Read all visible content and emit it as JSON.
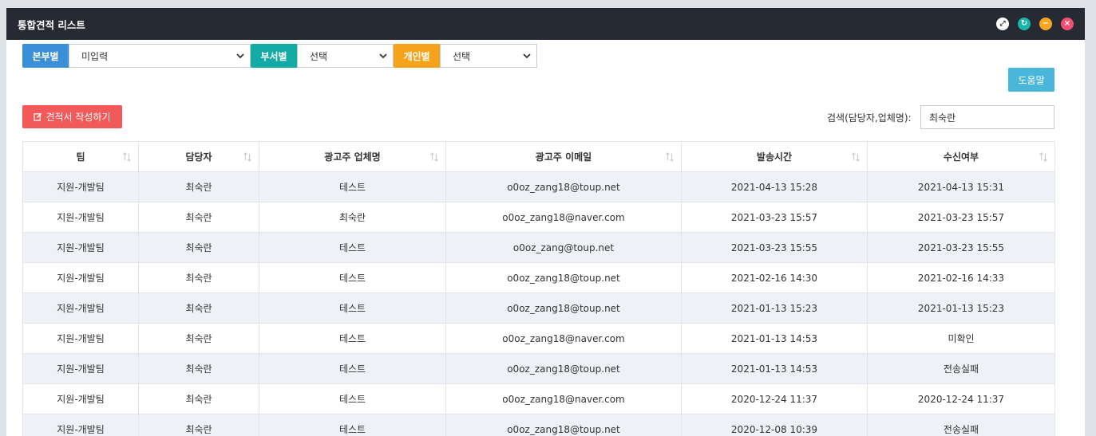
{
  "window": {
    "title": "통합견적 리스트"
  },
  "controls": {
    "expand": "⤢",
    "refresh": "↻",
    "minimize": "−",
    "close": "×"
  },
  "filters": [
    {
      "label": "본부별",
      "value": "미입력",
      "color": "#3b8fd6"
    },
    {
      "label": "부서별",
      "value": "선택",
      "color": "#14aaa6"
    },
    {
      "label": "개인별",
      "value": "선택",
      "color": "#f5a31a"
    }
  ],
  "help_button": "도움말",
  "write_button": "견적서 작성하기",
  "search": {
    "label": "검색(담당자,업체명):",
    "value": "최숙란"
  },
  "table": {
    "headers": [
      "팀",
      "담당자",
      "광고주 업체명",
      "광고주 이메일",
      "발송시간",
      "수신여부"
    ],
    "rows": [
      [
        "지원-개발팀",
        "최숙란",
        "테스트",
        "o0oz_zang18@toup.net",
        "2021-04-13 15:28",
        "2021-04-13 15:31"
      ],
      [
        "지원-개발팀",
        "최숙란",
        "최숙란",
        "o0oz_zang18@naver.com",
        "2021-03-23 15:57",
        "2021-03-23 15:57"
      ],
      [
        "지원-개발팀",
        "최숙란",
        "테스트",
        "o0oz_zang@toup.net",
        "2021-03-23 15:55",
        "2021-03-23 15:55"
      ],
      [
        "지원-개발팀",
        "최숙란",
        "테스트",
        "o0oz_zang18@toup.net",
        "2021-02-16 14:30",
        "2021-02-16 14:33"
      ],
      [
        "지원-개발팀",
        "최숙란",
        "테스트",
        "o0oz_zang18@toup.net",
        "2021-01-13 15:23",
        "2021-01-13 15:23"
      ],
      [
        "지원-개발팀",
        "최숙란",
        "테스트",
        "o0oz_zang18@naver.com",
        "2021-01-13 14:53",
        "미확인"
      ],
      [
        "지원-개발팀",
        "최숙란",
        "테스트",
        "o0oz_zang18@toup.net",
        "2021-01-13 14:53",
        "전송실패"
      ],
      [
        "지원-개발팀",
        "최숙란",
        "테스트",
        "o0oz_zang18@naver.com",
        "2020-12-24 11:37",
        "2020-12-24 11:37"
      ],
      [
        "지원-개발팀",
        "최숙란",
        "테스트",
        "o0oz_zang18@toup.net",
        "2020-12-08 10:39",
        "전송실패"
      ]
    ]
  }
}
